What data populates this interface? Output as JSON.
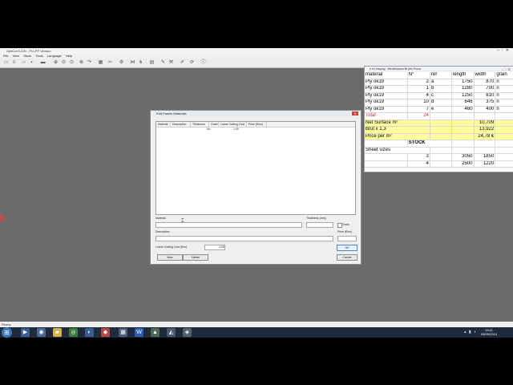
{
  "app": {
    "title": "OptiCut 5.22b - Pro-PP Version",
    "menu": [
      "File",
      "View",
      "Stock",
      "Tools",
      "Language",
      "Help"
    ],
    "status": "Ready"
  },
  "dialog": {
    "title": "Edit Panels Materials",
    "columns": [
      "Material",
      "Description",
      "Thickness",
      "Grain",
      "Linear Cutting Cost",
      "Price (€/m²)"
    ],
    "row": {
      "grain": "No",
      "linear_cost": "1.00"
    },
    "labels": {
      "material": "Material",
      "thickness": "Thickness (mm)",
      "description": "Description",
      "grain": "Grain",
      "price": "Price (€/m²)",
      "linear_cost": "Linear Cutting Cost (€/m)"
    },
    "linear_cost_value": "1.00",
    "buttons": {
      "new": "New",
      "delete": "Delete",
      "ok": "OK",
      "cancel": "Cancel"
    }
  },
  "sheet": {
    "title": "e.d.f.draping - Wenlineaues.lib.ptlo.Prosa",
    "header": [
      "material",
      "N°",
      "ref",
      "length",
      "width",
      "grain"
    ],
    "rows": [
      [
        "Ply ok19",
        "2",
        "a",
        "1750",
        "870",
        "n"
      ],
      [
        "Ply ok19",
        "1",
        "b",
        "1280",
        "700",
        "n"
      ],
      [
        "Ply ok19",
        "4",
        "c",
        "1250",
        "610",
        "n"
      ],
      [
        "Ply ok19",
        "10",
        "d",
        "646",
        "375",
        "n"
      ],
      [
        "Ply ok19",
        "7",
        "e",
        "460",
        "400",
        "n"
      ]
    ],
    "total_label": "Total",
    "total_value": "24",
    "net_surface_label": "Net Surface m²",
    "net_surface_value": "10,709",
    "brut_label": "Brut x 1,3",
    "brut_value": "13,922",
    "price_label": "Price per m²",
    "price_value": "24,78 €",
    "stock_label": "STOCK",
    "sheet_sizes_label": "Sheet sizes",
    "stock_rows": [
      [
        "3",
        "3050",
        "1850"
      ],
      [
        "4",
        "2500",
        "1220"
      ]
    ]
  },
  "taskbar": {
    "time": "15:11",
    "date": "05/09/2014"
  },
  "colors": {
    "yellow": "#ffff9e",
    "total_red": "#d9231d",
    "desktop": "#6b6b6b"
  }
}
